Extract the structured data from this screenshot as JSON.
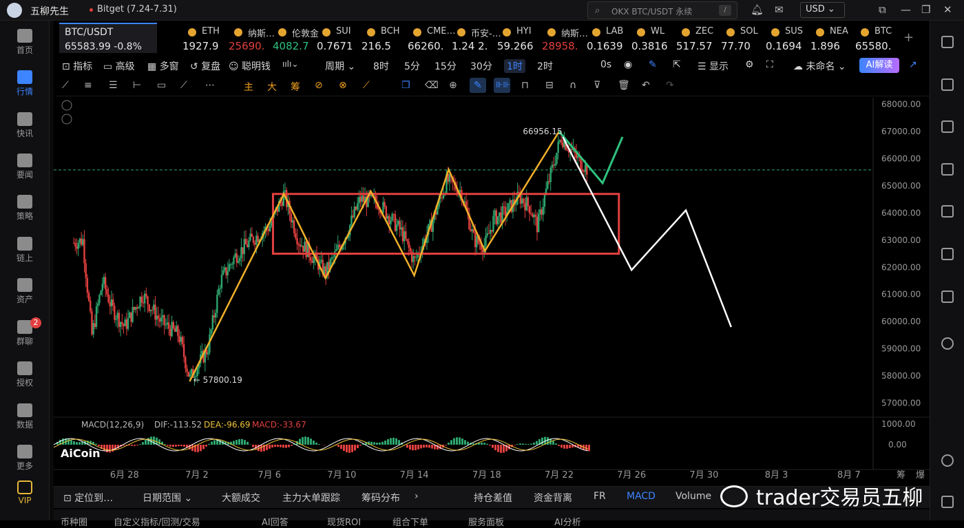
{
  "app": {
    "title": "五柳先生",
    "tab": "Bitget (7.24-7.31)",
    "search_placeholder": "OKX BTC/USDT 永续",
    "currency": "USD"
  },
  "sidebar": [
    {
      "label": "首页",
      "icon": "home-icon"
    },
    {
      "label": "行情",
      "icon": "market-icon"
    },
    {
      "label": "快讯",
      "icon": "flash-news-icon"
    },
    {
      "label": "要闻",
      "icon": "news-icon"
    },
    {
      "label": "策略",
      "icon": "strategy-icon"
    },
    {
      "label": "链上",
      "icon": "chain-icon"
    },
    {
      "label": "资产",
      "icon": "wallet-icon"
    },
    {
      "label": "群聊",
      "icon": "chat-icon",
      "badge": "2"
    },
    {
      "label": "授权",
      "icon": "auth-icon"
    },
    {
      "label": "数据",
      "icon": "data-icon"
    },
    {
      "label": "更多",
      "icon": "more-icon"
    },
    {
      "label": "VIP",
      "icon": "vip-icon"
    }
  ],
  "symbol": {
    "name": "BTC/USDT",
    "price": "65583.99",
    "change": "-0.8%"
  },
  "tickers": [
    {
      "name": "ETH",
      "price": "1927.9",
      "color": "#e6e6e6"
    },
    {
      "name": "纳斯…",
      "price": "25690.",
      "color": "#e2403f"
    },
    {
      "name": "伦敦金",
      "price": "4082.7",
      "color": "#2ec27e"
    },
    {
      "name": "SUI",
      "price": "0.7671",
      "color": "#e6e6e6"
    },
    {
      "name": "BCH",
      "price": "216.5",
      "color": "#e6e6e6"
    },
    {
      "name": "CME…",
      "price": "66260.",
      "color": "#e6e6e6"
    },
    {
      "name": "币安-…",
      "price": "1.24 2.",
      "color": "#e6e6e6"
    },
    {
      "name": "HYI",
      "price": "59.266",
      "color": "#e6e6e6"
    },
    {
      "name": "纳斯…",
      "price": "28958.",
      "color": "#e2403f"
    },
    {
      "name": "LAB",
      "price": "0.1639",
      "color": "#e6e6e6"
    },
    {
      "name": "WL",
      "price": "0.3816",
      "color": "#e6e6e6"
    },
    {
      "name": "ZEC",
      "price": "517.57",
      "color": "#e6e6e6"
    },
    {
      "name": "SOL",
      "price": "77.70",
      "color": "#e6e6e6"
    },
    {
      "name": "SUS",
      "price": "0.1694",
      "color": "#e6e6e6"
    },
    {
      "name": "NEA",
      "price": "1.896",
      "color": "#e6e6e6"
    },
    {
      "name": "BTC",
      "price": "65580.",
      "color": "#e6e6e6"
    }
  ],
  "toolbar": {
    "indicators": "指标",
    "advanced": "高级",
    "multiwin": "多窗",
    "replay": "复盘",
    "smart": "聪明钱",
    "period": "周期",
    "p8h": "8时",
    "p5m": "5分",
    "p15m": "15分",
    "p30m": "30分",
    "p1h": "1时",
    "p2h": "2时",
    "countdown": "0s",
    "display": "显示",
    "unnamed": "未命名",
    "ai": "AI解读"
  },
  "drawtools": {
    "main": "主",
    "big": "大",
    "chips": "筹"
  },
  "chart_data": {
    "type": "candlestick",
    "y_axis": [
      "68000.00",
      "67000.00",
      "66000.00",
      "65000.00",
      "64000.00",
      "63000.00",
      "62000.00",
      "61000.00",
      "60000.00",
      "59000.00",
      "58000.00",
      "57000.00"
    ],
    "x_axis": [
      "6月 28",
      "7月 2",
      "7月 6",
      "7月 10",
      "7月 14",
      "7月 18",
      "7月 22",
      "7月 26",
      "7月 30",
      "8月 3",
      "8月 7"
    ],
    "high_label": "66956.15",
    "low_label": "← 57800.19",
    "current_price": 65583.99,
    "macd": {
      "label": "MACD(12,26,9)",
      "dif": "DIF:-113.52",
      "dea": "DEA:-96.69",
      "macd": "MACD:-33.67",
      "axis": [
        "1000.00",
        "0.00"
      ]
    },
    "watermark": "AiCoin",
    "corner": [
      "筹",
      "爆"
    ]
  },
  "bottom_tabs": [
    "定位到…",
    "日期范围",
    "大额成交",
    "主力大单跟踪",
    "筹码分布",
    "持仓差值",
    "资金背离",
    "FR",
    "MACD",
    "Volume"
  ],
  "weibo_watermark": "trader交易员五柳",
  "last_row": [
    "币种圈",
    "自定义指标/回测/交易",
    "AI回答",
    "现货ROI",
    "组合下单",
    "服务面板",
    "AI分析"
  ]
}
